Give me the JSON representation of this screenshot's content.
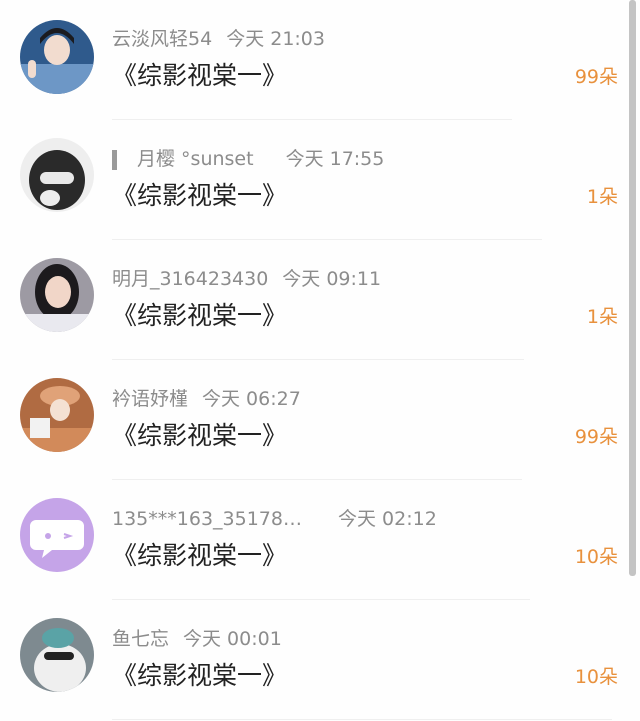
{
  "items": [
    {
      "name": "云淡风轻54",
      "time": "今天 21:03",
      "title": "《综影视棠一》",
      "count": "99朵",
      "avatar": "avatar-boy-peace-sign-icon",
      "avatar_color": "#2f5a8c"
    },
    {
      "name": "月樱 °sunset",
      "time": "今天 17:55",
      "title": "《综影视棠一》",
      "count": "1朵",
      "avatar": "avatar-masked-person-icon",
      "avatar_color": "#2a2a2a"
    },
    {
      "name": "明月_316423430",
      "time": "今天 09:11",
      "title": "《综影视棠一》",
      "count": "1朵",
      "avatar": "avatar-girl-portrait-icon",
      "avatar_color": "#6b6b7b"
    },
    {
      "name": "衿语妤槿",
      "time": "今天 06:27",
      "title": "《综影视棠一》",
      "count": "99朵",
      "avatar": "avatar-hat-person-icon",
      "avatar_color": "#b06b42"
    },
    {
      "name": "135***163_35178…",
      "time": "今天 02:12",
      "title": "《综影视棠一》",
      "count": "10朵",
      "avatar": "avatar-chat-bubble-icon",
      "avatar_color": "#c5a4e8"
    },
    {
      "name": "鱼七忘",
      "time": "今天 00:01",
      "title": "《综影视棠一》",
      "count": "10朵",
      "avatar": "avatar-cat-sunglasses-icon",
      "avatar_color": "#7e8a90"
    }
  ]
}
